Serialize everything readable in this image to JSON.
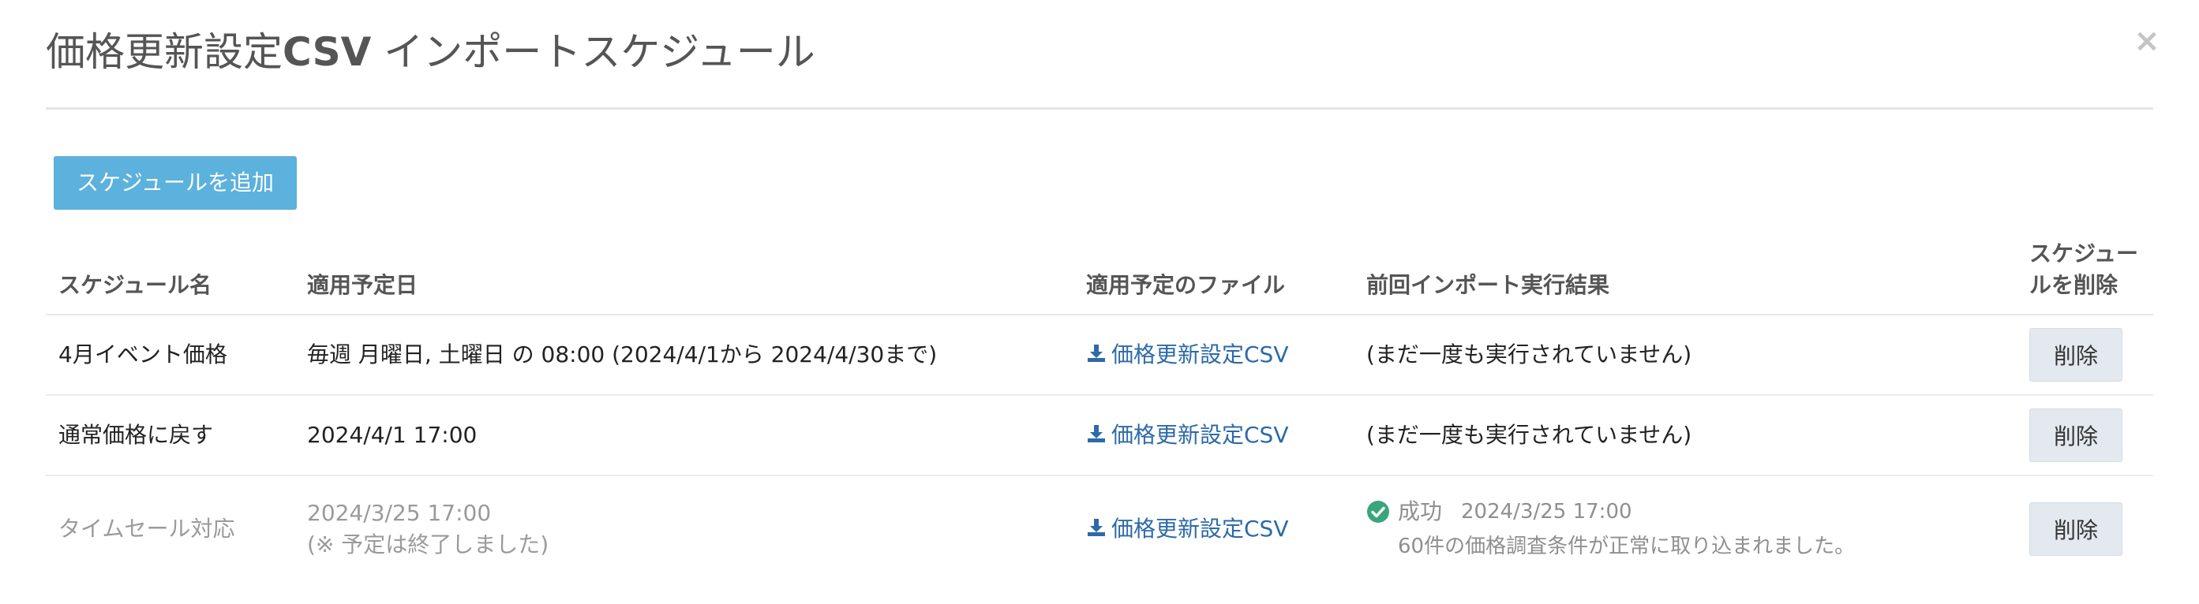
{
  "modal": {
    "title_main": "価格更新設定",
    "title_csv": "CSV",
    "title_rest": " インポートスケジュール",
    "close_label": "×",
    "add_button_label": "スケジュールを追加"
  },
  "table": {
    "headers": {
      "name": "スケジュール名",
      "date": "適用予定日",
      "file": "適用予定のファイル",
      "result": "前回インポート実行結果",
      "delete": "スケジュールを削除"
    },
    "rows": [
      {
        "name": "4月イベント価格",
        "date": "毎週 月曜日, 土曜日 の 08:00 (2024/4/1から 2024/4/30まで)",
        "file": "価格更新設定CSV",
        "result": "(まだ一度も実行されていません)",
        "delete_label": "削除"
      },
      {
        "name": "通常価格に戻す",
        "date": "2024/4/1 17:00",
        "file": "価格更新設定CSV",
        "result": "(まだ一度も実行されていません)",
        "delete_label": "削除"
      },
      {
        "name": "タイムセール対応",
        "date": "2024/3/25 17:00",
        "date_note": "(※ 予定は終了しました)",
        "file": "価格更新設定CSV",
        "result_status": "成功",
        "result_date": "2024/3/25 17:00",
        "result_message": "60件の価格調査条件が正常に取り込まれました。",
        "delete_label": "削除"
      }
    ]
  },
  "icons": {
    "download": "download-icon",
    "success": "check-circle-icon",
    "close": "close-icon"
  },
  "colors": {
    "primary_button": "#5cb1dd",
    "link": "#2d6aa8",
    "success": "#3aa57c",
    "muted_text": "#9a9a9a",
    "delete_button_bg": "#e3e9ee"
  }
}
